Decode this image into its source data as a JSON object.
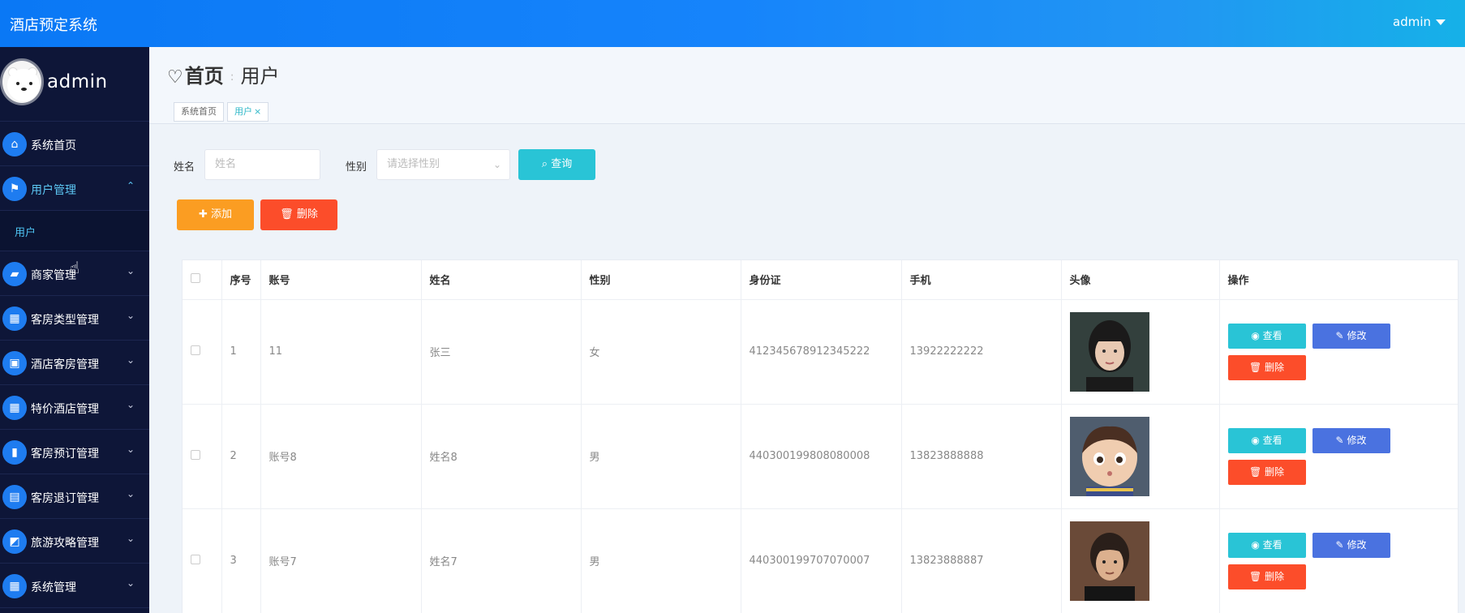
{
  "topbar": {
    "title": "酒店预定系统",
    "user": "admin"
  },
  "sidebar": {
    "username": "admin",
    "items": [
      {
        "label": "系统首页",
        "icon": "home-icon",
        "glyph": "⌂"
      },
      {
        "label": "用户管理",
        "icon": "flag-icon",
        "glyph": "⚑",
        "expanded": true
      },
      {
        "label": "商家管理",
        "icon": "store-icon",
        "glyph": "▰"
      },
      {
        "label": "客房类型管理",
        "icon": "grid-icon",
        "glyph": "▦"
      },
      {
        "label": "酒店客房管理",
        "icon": "briefcase-icon",
        "glyph": "▣"
      },
      {
        "label": "特价酒店管理",
        "icon": "apps-icon",
        "glyph": "▦"
      },
      {
        "label": "客房预订管理",
        "icon": "bar-chart-icon",
        "glyph": "▮"
      },
      {
        "label": "客房退订管理",
        "icon": "chat-icon",
        "glyph": "▤"
      },
      {
        "label": "旅游攻略管理",
        "icon": "trend-chart-icon",
        "glyph": "◩"
      },
      {
        "label": "系统管理",
        "icon": "apps-icon",
        "glyph": "▦"
      }
    ],
    "subitem": "用户",
    "chevron_down": "⌄",
    "chevron_up": "⌃"
  },
  "breadcrumb": {
    "home": "首页",
    "current": "用户"
  },
  "tags": {
    "home": "系统首页",
    "current": "用户",
    "close": "×"
  },
  "search": {
    "name_label": "姓名",
    "name_placeholder": "姓名",
    "gender_label": "性别",
    "gender_placeholder": "请选择性别",
    "query_button": "查询"
  },
  "actions": {
    "add": "添加",
    "delete": "删除"
  },
  "table": {
    "headers": [
      "序号",
      "账号",
      "姓名",
      "性别",
      "身份证",
      "手机",
      "头像",
      "操作"
    ],
    "rows": [
      {
        "index": "1",
        "account": "11",
        "name": "张三",
        "gender": "女",
        "id_card": "412345678912345222",
        "phone": "13922222222"
      },
      {
        "index": "2",
        "account": "账号8",
        "name": "姓名8",
        "gender": "男",
        "id_card": "440300199808080008",
        "phone": "13823888888"
      },
      {
        "index": "3",
        "account": "账号7",
        "name": "姓名7",
        "gender": "男",
        "id_card": "440300199707070007",
        "phone": "13823888887"
      }
    ],
    "ops": {
      "view": "查看",
      "edit": "修改",
      "remove": "删除"
    }
  },
  "colors": {
    "topbar": "#0a78f5",
    "sidebar": "#0e1638",
    "query": "#29c4d6",
    "add": "#fb9d22",
    "delete": "#fc4d2a",
    "edit": "#4a72e0"
  }
}
